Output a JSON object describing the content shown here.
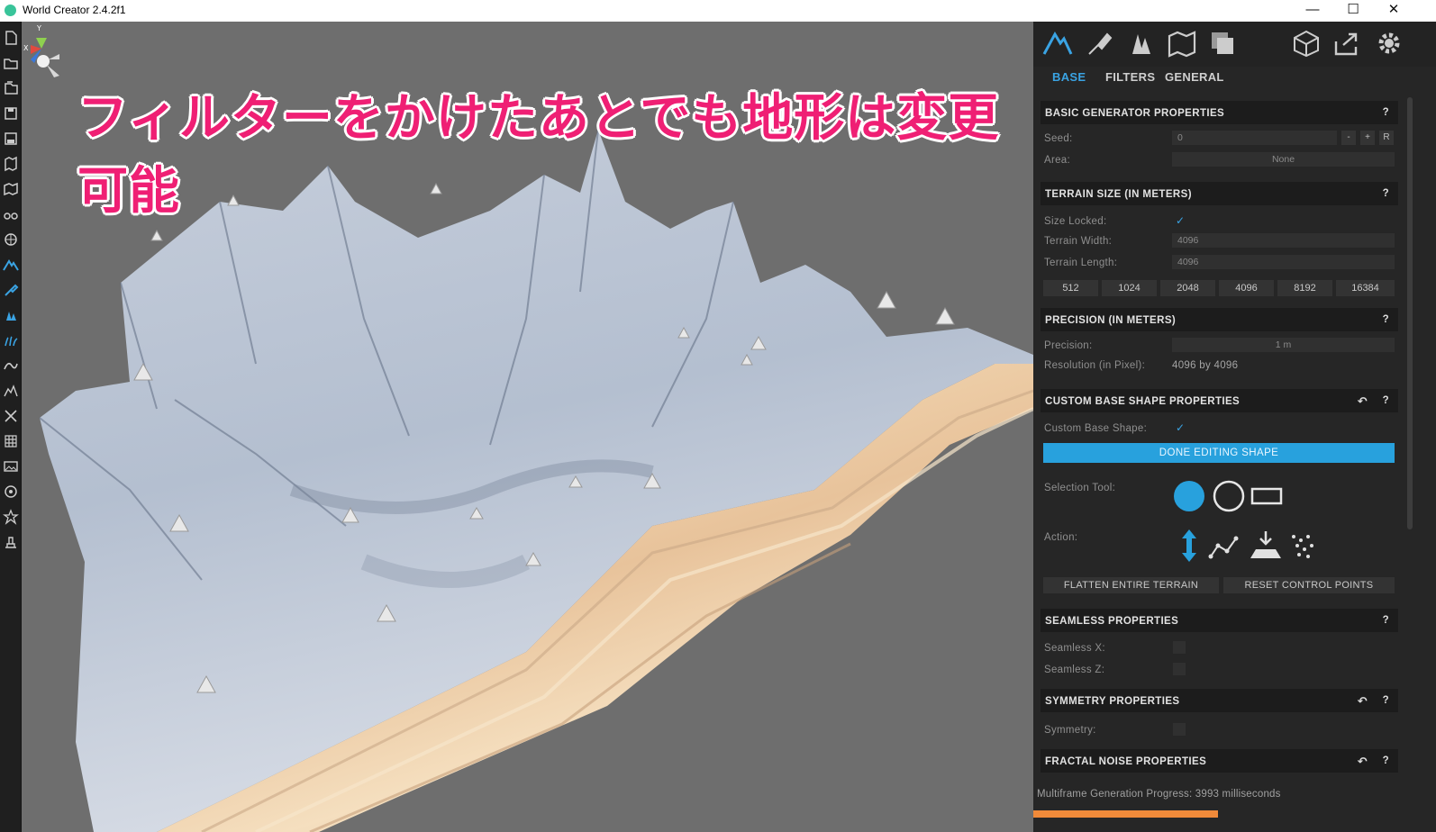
{
  "window": {
    "title": "World Creator 2.4.2f1",
    "controls": {
      "minimize": "—",
      "maximize": "☐",
      "close": "✕"
    }
  },
  "viewport": {
    "headline": "フィルターをかけたあとでも地形は変更可能",
    "gizmo_axis_y": "Y",
    "gizmo_axis_x": "X"
  },
  "panel": {
    "tabs": [
      {
        "label": "BASE",
        "active": true
      },
      {
        "label": "FILTERS",
        "active": false
      },
      {
        "label": "GENERAL",
        "active": false
      }
    ],
    "basic": {
      "title": "BASIC GENERATOR PROPERTIES",
      "help": "?",
      "seed_label": "Seed:",
      "seed_value": "0",
      "seed_minus": "-",
      "seed_plus": "+",
      "seed_random": "R",
      "area_label": "Area:",
      "area_value": "None"
    },
    "terrain_size": {
      "title": "TERRAIN SIZE (IN METERS)",
      "help": "?",
      "size_locked_label": "Size Locked:",
      "width_label": "Terrain Width:",
      "width_value": "4096",
      "length_label": "Terrain Length:",
      "length_value": "4096",
      "presets": [
        "512",
        "1024",
        "2048",
        "4096",
        "8192",
        "16384"
      ]
    },
    "precision": {
      "title": "PRECISION (IN METERS)",
      "help": "?",
      "precision_label": "Precision:",
      "precision_value": "1 m",
      "resolution_label": "Resolution (in Pixel):",
      "resolution_value": "4096 by 4096"
    },
    "custom_base": {
      "title": "CUSTOM BASE SHAPE PROPERTIES",
      "help": "?",
      "reset": "↶",
      "custom_label": "Custom Base Shape:",
      "done_button": "DONE EDITING SHAPE",
      "selection_label": "Selection Tool:",
      "action_label": "Action:",
      "flatten_button": "FLATTEN ENTIRE TERRAIN",
      "reset_points_button": "RESET CONTROL POINTS"
    },
    "seamless": {
      "title": "SEAMLESS PROPERTIES",
      "help": "?",
      "x_label": "Seamless X:",
      "z_label": "Seamless Z:"
    },
    "symmetry": {
      "title": "SYMMETRY PROPERTIES",
      "help": "?",
      "reset": "↶",
      "label": "Symmetry:"
    },
    "fractal": {
      "title": "FRACTAL NOISE PROPERTIES",
      "help": "?",
      "reset": "↶"
    },
    "status": "Multiframe Generation Progress: 3993 milliseconds",
    "accent": "#28a1dd",
    "progress_color": "#f08a3a"
  }
}
